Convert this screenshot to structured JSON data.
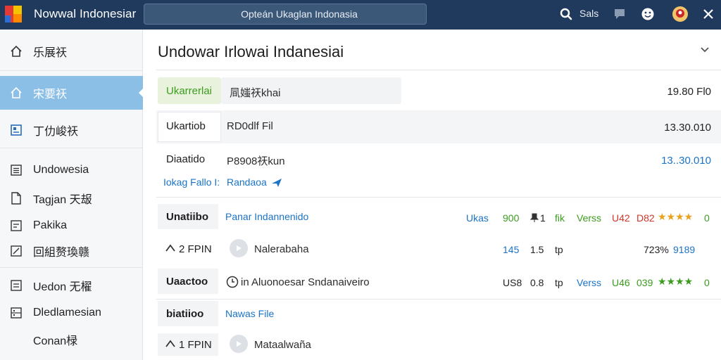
{
  "header": {
    "app_title": "Nowwal Indonesiar",
    "search_placeholder": "Opteán Ukaglan Indonasia",
    "status_label": "Sals"
  },
  "sidebar": {
    "items": [
      {
        "label": "乐展祆",
        "icon": "home-icon"
      },
      {
        "label": "宋要祆",
        "icon": "home-icon"
      },
      {
        "label": "丁仂峻祆",
        "icon": "image-icon"
      },
      {
        "label": "Undowesia",
        "icon": "list-icon"
      },
      {
        "label": "Tagjan 天叝",
        "icon": "document-icon"
      },
      {
        "label": "Pakika",
        "icon": "form-icon"
      },
      {
        "label": "回組赘瑍赣",
        "icon": "edit-icon"
      },
      {
        "label": "Uedon 无櫂",
        "icon": "list-icon"
      },
      {
        "label": "Dledlamesian",
        "icon": "grid-icon"
      },
      {
        "label": "Conan椂",
        "icon": ""
      }
    ]
  },
  "main": {
    "title": "Undowar Irlowai Indanesiai",
    "rows": {
      "r1": {
        "label": "Ukarrerlai",
        "text": "凬媸祆khai",
        "value": "19.80 Fl0"
      },
      "r2": {
        "label": "Ukartiob",
        "text": "RD0dlf Fil",
        "value": "13.30.010"
      },
      "r3": {
        "label": "Diaatido",
        "text": "P8908祆kun",
        "value": "13..30.010",
        "link_label": "Iokag Fallo I:",
        "link_text": "Randaoa"
      },
      "r4": {
        "label": "Unatiibo",
        "text": "Panar Indannenido",
        "c1": "Ukas",
        "c2": "900",
        "c3": "1",
        "c4": "fik",
        "c5": "Verss",
        "c6": "U42",
        "c7": "D82",
        "stars": "★★★★",
        "c8": "0"
      },
      "r5": {
        "label": "2 FPIN",
        "text": "Nalerabaha",
        "c1": "145",
        "c2": "1.5",
        "c3": "tp",
        "c4": "723%",
        "c5": "9189"
      },
      "r6": {
        "label": "Uaactoo",
        "text": "in  Aluonoesar Sndanaiveiro",
        "c1": "US8",
        "c2": "0.8",
        "c3": "tp",
        "c5": "Verss",
        "c6": "U46",
        "c7": "039",
        "stars": "★★★★",
        "c8": "0"
      },
      "r7": {
        "label": "biatiioo",
        "text": "Nawas File"
      },
      "r8": {
        "label": "1 FPIN",
        "text": "Mataalwaña"
      }
    }
  },
  "colors": {
    "topbar": "#1f3a5c",
    "sidebar_active": "#8bbfe6",
    "link_blue": "#1b73c7",
    "green": "#3b9c1e",
    "red": "#d2362a",
    "star_gold": "#e8a21c"
  }
}
